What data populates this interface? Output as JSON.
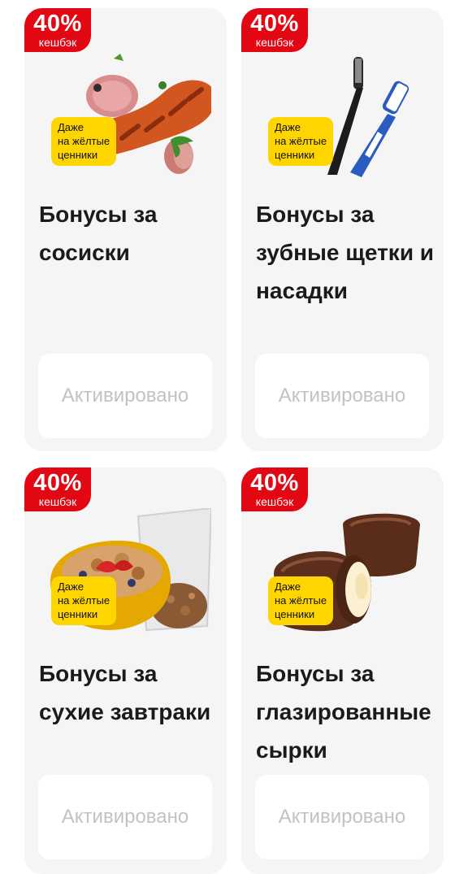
{
  "cards": [
    {
      "badge": {
        "percent": "40%",
        "label": "кешбэк"
      },
      "sticker": {
        "line1": "Даже",
        "line2": "на жёлтые",
        "line3": "ценники"
      },
      "title": "Бонусы за сосиски",
      "button": "Активировано",
      "icon": "sausage-icon"
    },
    {
      "badge": {
        "percent": "40%",
        "label": "кешбэк"
      },
      "sticker": {
        "line1": "Даже",
        "line2": "на жёлтые",
        "line3": "ценники"
      },
      "title": "Бонусы за зубные щетки и насадки",
      "button": "Активировано",
      "icon": "toothbrush-icon"
    },
    {
      "badge": {
        "percent": "40%",
        "label": "кешбэк"
      },
      "sticker": {
        "line1": "Даже",
        "line2": "на жёлтые",
        "line3": "ценники"
      },
      "title": "Бонусы за сухие завтраки",
      "button": "Активировано",
      "icon": "cereal-bowl-icon"
    },
    {
      "badge": {
        "percent": "40%",
        "label": "кешбэк"
      },
      "sticker": {
        "line1": "Даже",
        "line2": "на жёлтые",
        "line3": "ценники"
      },
      "title": "Бонусы за глазированные сырки",
      "button": "Активировано",
      "icon": "glazed-curd-icon"
    }
  ],
  "colors": {
    "badge": "#e30613",
    "sticker": "#ffd500",
    "card_bg": "#f5f5f5",
    "button_text": "#c2c2c2"
  }
}
